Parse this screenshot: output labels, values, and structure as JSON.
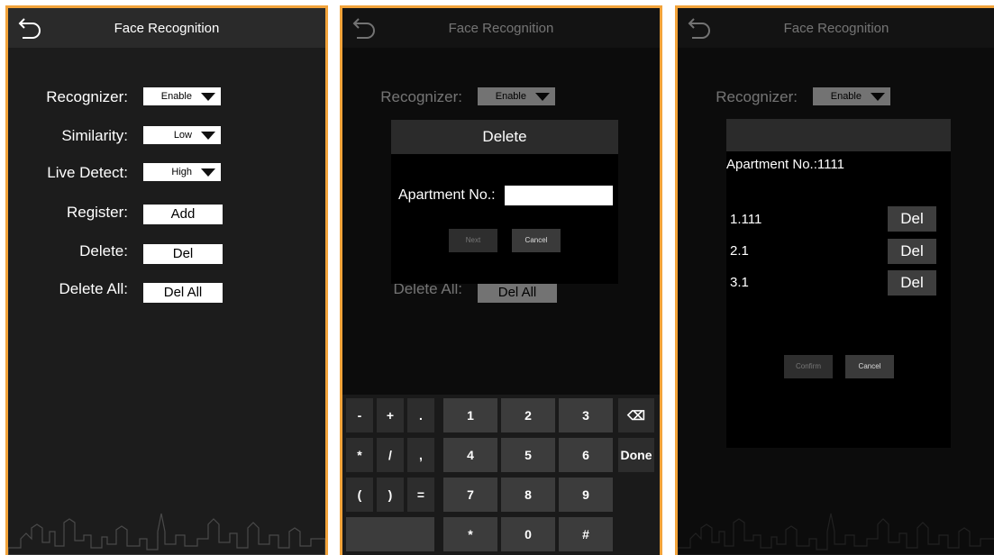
{
  "header": {
    "title": "Face Recognition",
    "back_icon": "back-arrow-icon"
  },
  "settings": {
    "recognizer": {
      "label": "Recognizer:",
      "value": "Enable"
    },
    "similarity": {
      "label": "Similarity:",
      "value": "Low"
    },
    "live_detect": {
      "label": "Live Detect:",
      "value": "High"
    },
    "register": {
      "label": "Register:",
      "button": "Add"
    },
    "delete": {
      "label": "Delete:",
      "button": "Del"
    },
    "delete_all": {
      "label": "Delete All:",
      "button": "Del All"
    }
  },
  "delete_dialog": {
    "title": "Delete",
    "field_label": "Apartment No.:",
    "field_value": "",
    "next": "Next",
    "cancel": "Cancel"
  },
  "keyboard": {
    "rows": [
      [
        "-",
        "+",
        ".",
        "1",
        "2",
        "3",
        "⌫"
      ],
      [
        "*",
        "/",
        ",",
        "4",
        "5",
        "6",
        "Done"
      ],
      [
        "(",
        ")",
        "=",
        "7",
        "8",
        "9"
      ],
      [
        "",
        "*",
        "0",
        "#"
      ]
    ]
  },
  "list_dialog": {
    "heading": "Apartment No.:1111",
    "items": [
      {
        "label": "1.111",
        "button": "Del"
      },
      {
        "label": "2.1",
        "button": "Del"
      },
      {
        "label": "3.1",
        "button": "Del"
      }
    ],
    "confirm": "Confirm",
    "cancel": "Cancel"
  },
  "colors": {
    "frame": "#f2a33a",
    "background": "#1c1c1c",
    "header": "#2a2a2a"
  }
}
